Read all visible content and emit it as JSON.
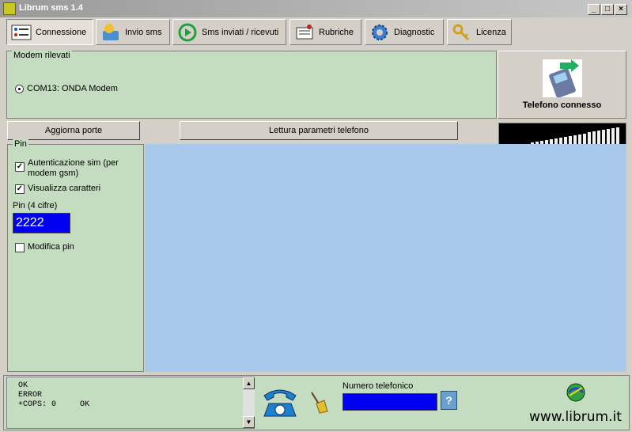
{
  "window": {
    "title": "Librum sms 1.4"
  },
  "toolbar": {
    "tabs": [
      {
        "label": "Connessione"
      },
      {
        "label": "Invio sms"
      },
      {
        "label": "Sms inviati / ricevuti"
      },
      {
        "label": "Rubriche"
      },
      {
        "label": "Diagnostic"
      },
      {
        "label": "Licenza"
      }
    ]
  },
  "modem": {
    "group_title": "Modem rilevati",
    "ports": [
      {
        "label": "COM13: ONDA Modem",
        "selected": true
      }
    ]
  },
  "phone_status": {
    "label": "Telefono connesso",
    "icon": "phone-connected-icon"
  },
  "buttons": {
    "refresh_ports": "Aggiorna porte",
    "read_params": "Lettura parametri telefono"
  },
  "pin": {
    "group_title": "Pin",
    "auth_sim_label": "Autenticazione sim (per modem gsm)",
    "auth_sim_checked": true,
    "show_chars_label": "Visualizza caratteri",
    "show_chars_checked": true,
    "pin_label": "Pin (4 cifre)",
    "pin_value": "2222",
    "modify_pin_label": "Modifica pin",
    "modify_pin_checked": false
  },
  "signal": {
    "bars_total": 25,
    "bars_lit": 25
  },
  "log": {
    "lines": [
      "OK",
      "ERROR",
      "+COPS: 0     OK"
    ]
  },
  "phone_number": {
    "label": "Numero telefonico",
    "value": ""
  },
  "footer": {
    "website": "www.librum.it"
  },
  "colors": {
    "panel_green": "#c4dcc0",
    "main_blue": "#a8c8ec",
    "input_blue": "#0000f0"
  }
}
